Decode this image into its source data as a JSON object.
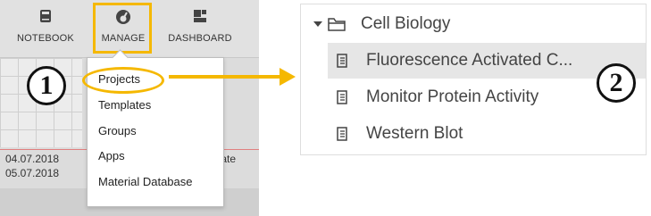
{
  "navbar": {
    "items": [
      {
        "label": "NOTEBOOK",
        "icon": "notebook-icon"
      },
      {
        "label": "MANAGE",
        "icon": "gauge-icon"
      },
      {
        "label": "DASHBOARD",
        "icon": "dashboard-icon"
      }
    ]
  },
  "manage_menu": {
    "items": [
      "Projects",
      "Templates",
      "Groups",
      "Apps",
      "Material Database"
    ]
  },
  "background": {
    "dates": [
      "04.07.2018",
      "05.07.2018"
    ],
    "truncated_text": "ociate"
  },
  "steps": {
    "one": "1",
    "two": "2"
  },
  "tree": {
    "folder": "Cell Biology",
    "items": [
      {
        "label": "Fluorescence Activated C...",
        "selected": true
      },
      {
        "label": "Monitor Protein Activity",
        "selected": false
      },
      {
        "label": "Western Blot",
        "selected": false
      }
    ]
  },
  "colors": {
    "highlight": "#f5b800",
    "selected_row": "#e6e6e6"
  }
}
